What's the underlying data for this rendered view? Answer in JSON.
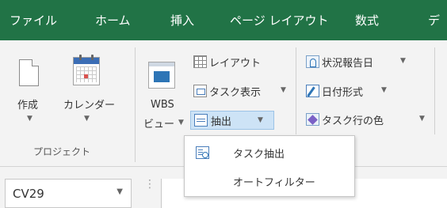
{
  "tabs": [
    {
      "label": "ファイル"
    },
    {
      "label": "ホーム"
    },
    {
      "label": "挿入"
    },
    {
      "label": "ページ レイアウト"
    },
    {
      "label": "数式"
    },
    {
      "label": "デ"
    }
  ],
  "ribbon": {
    "project_group": {
      "create_label": "作成",
      "calendar_label": "カレンダー",
      "group_label": "プロジェクト"
    },
    "view_group": {
      "wbs_label_1": "WBS",
      "wbs_label_2": "ビュー",
      "layout_label": "レイアウト",
      "task_display_label": "タスク表示",
      "extract_label": "抽出"
    },
    "format_group": {
      "status_date_label": "状況報告日",
      "date_format_label": "日付形式",
      "task_row_color_label": "タスク行の色"
    }
  },
  "menu": {
    "items": [
      {
        "label": "タスク抽出"
      },
      {
        "label": "オートフィルター"
      }
    ]
  },
  "namebox": {
    "value": "CV29"
  },
  "colors": {
    "tab_bar": "#217346",
    "ribbon_bg": "#f3f3f3"
  }
}
